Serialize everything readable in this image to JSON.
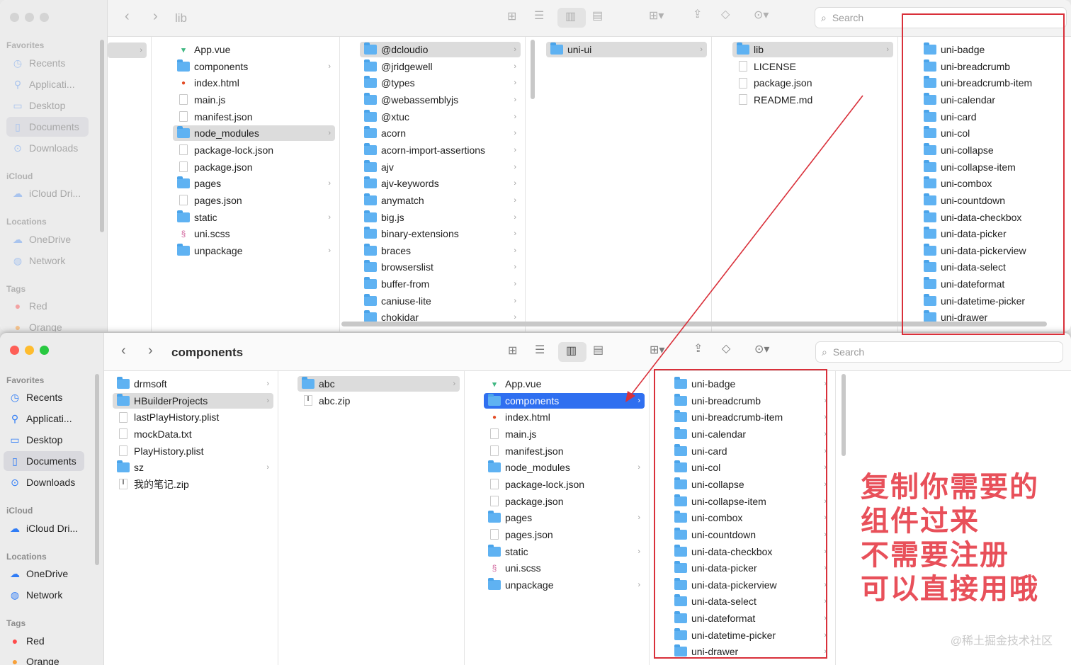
{
  "top_window": {
    "title": "lib",
    "search_placeholder": "Search",
    "sidebar": {
      "favorites_label": "Favorites",
      "favorites": [
        "Recents",
        "Applicati...",
        "Desktop",
        "Documents",
        "Downloads"
      ],
      "icloud_label": "iCloud",
      "icloud": [
        "iCloud Dri..."
      ],
      "locations_label": "Locations",
      "locations": [
        "OneDrive",
        "Network"
      ],
      "tags_label": "Tags",
      "tags": [
        "Red",
        "Orange"
      ]
    },
    "col1": [
      {
        "name": "App.vue",
        "type": "vue"
      },
      {
        "name": "components",
        "type": "folder",
        "chev": true
      },
      {
        "name": "index.html",
        "type": "html"
      },
      {
        "name": "main.js",
        "type": "doc"
      },
      {
        "name": "manifest.json",
        "type": "doc"
      },
      {
        "name": "node_modules",
        "type": "folder",
        "chev": true,
        "sel": true
      },
      {
        "name": "package-lock.json",
        "type": "doc"
      },
      {
        "name": "package.json",
        "type": "doc"
      },
      {
        "name": "pages",
        "type": "folder",
        "chev": true
      },
      {
        "name": "pages.json",
        "type": "doc"
      },
      {
        "name": "static",
        "type": "folder",
        "chev": true
      },
      {
        "name": "uni.scss",
        "type": "scss"
      },
      {
        "name": "unpackage",
        "type": "folder",
        "chev": true
      }
    ],
    "col2": [
      {
        "name": "@dcloudio",
        "sel": true
      },
      {
        "name": "@jridgewell"
      },
      {
        "name": "@types"
      },
      {
        "name": "@webassemblyjs"
      },
      {
        "name": "@xtuc"
      },
      {
        "name": "acorn"
      },
      {
        "name": "acorn-import-assertions"
      },
      {
        "name": "ajv"
      },
      {
        "name": "ajv-keywords"
      },
      {
        "name": "anymatch"
      },
      {
        "name": "big.js"
      },
      {
        "name": "binary-extensions"
      },
      {
        "name": "braces"
      },
      {
        "name": "browserslist"
      },
      {
        "name": "buffer-from"
      },
      {
        "name": "caniuse-lite"
      },
      {
        "name": "chokidar"
      }
    ],
    "col3": [
      {
        "name": "uni-ui",
        "sel": true
      }
    ],
    "col4": [
      {
        "name": "lib",
        "type": "folder",
        "chev": true,
        "sel": true
      },
      {
        "name": "LICENSE",
        "type": "doc"
      },
      {
        "name": "package.json",
        "type": "doc"
      },
      {
        "name": "README.md",
        "type": "doc"
      }
    ],
    "col5": [
      "uni-badge",
      "uni-breadcrumb",
      "uni-breadcrumb-item",
      "uni-calendar",
      "uni-card",
      "uni-col",
      "uni-collapse",
      "uni-collapse-item",
      "uni-combox",
      "uni-countdown",
      "uni-data-checkbox",
      "uni-data-picker",
      "uni-data-pickerview",
      "uni-data-select",
      "uni-dateformat",
      "uni-datetime-picker",
      "uni-drawer"
    ]
  },
  "bottom_window": {
    "title": "components",
    "search_placeholder": "Search",
    "sidebar": {
      "favorites_label": "Favorites",
      "favorites": [
        "Recents",
        "Applicati...",
        "Desktop",
        "Documents",
        "Downloads"
      ],
      "icloud_label": "iCloud",
      "icloud": [
        "iCloud Dri..."
      ],
      "locations_label": "Locations",
      "locations": [
        "OneDrive",
        "Network"
      ],
      "tags_label": "Tags",
      "tags": [
        "Red",
        "Orange"
      ]
    },
    "col1": [
      {
        "name": "drmsoft",
        "type": "folder",
        "chev": true
      },
      {
        "name": "HBuilderProjects",
        "type": "folder",
        "chev": true,
        "sel": true
      },
      {
        "name": "lastPlayHistory.plist",
        "type": "doc"
      },
      {
        "name": "mockData.txt",
        "type": "doc"
      },
      {
        "name": "PlayHistory.plist",
        "type": "doc"
      },
      {
        "name": "sz",
        "type": "folder",
        "chev": true
      },
      {
        "name": "我的笔记.zip",
        "type": "zip"
      }
    ],
    "col2": [
      {
        "name": "abc",
        "type": "folder",
        "chev": true,
        "sel": true
      },
      {
        "name": "abc.zip",
        "type": "zip"
      }
    ],
    "col3": [
      {
        "name": "App.vue",
        "type": "vue"
      },
      {
        "name": "components",
        "type": "folder",
        "chev": true,
        "act": true
      },
      {
        "name": "index.html",
        "type": "html"
      },
      {
        "name": "main.js",
        "type": "doc"
      },
      {
        "name": "manifest.json",
        "type": "doc"
      },
      {
        "name": "node_modules",
        "type": "folder",
        "chev": true
      },
      {
        "name": "package-lock.json",
        "type": "doc"
      },
      {
        "name": "package.json",
        "type": "doc"
      },
      {
        "name": "pages",
        "type": "folder",
        "chev": true
      },
      {
        "name": "pages.json",
        "type": "doc"
      },
      {
        "name": "static",
        "type": "folder",
        "chev": true
      },
      {
        "name": "uni.scss",
        "type": "scss"
      },
      {
        "name": "unpackage",
        "type": "folder",
        "chev": true
      }
    ],
    "col4": [
      "uni-badge",
      "uni-breadcrumb",
      "uni-breadcrumb-item",
      "uni-calendar",
      "uni-card",
      "uni-col",
      "uni-collapse",
      "uni-collapse-item",
      "uni-combox",
      "uni-countdown",
      "uni-data-checkbox",
      "uni-data-picker",
      "uni-data-pickerview",
      "uni-data-select",
      "uni-dateformat",
      "uni-datetime-picker",
      "uni-drawer"
    ]
  },
  "annotation": {
    "lines": [
      "复制你需要的",
      "组件过来",
      "不需要注册",
      "可以直接用哦"
    ],
    "color": "#e8505a"
  },
  "watermark": "@稀土掘金技术社区",
  "colors": {
    "accent": "#2f6ff0",
    "highlight_box": "#d9303a",
    "folder": "#5fb2f2"
  }
}
